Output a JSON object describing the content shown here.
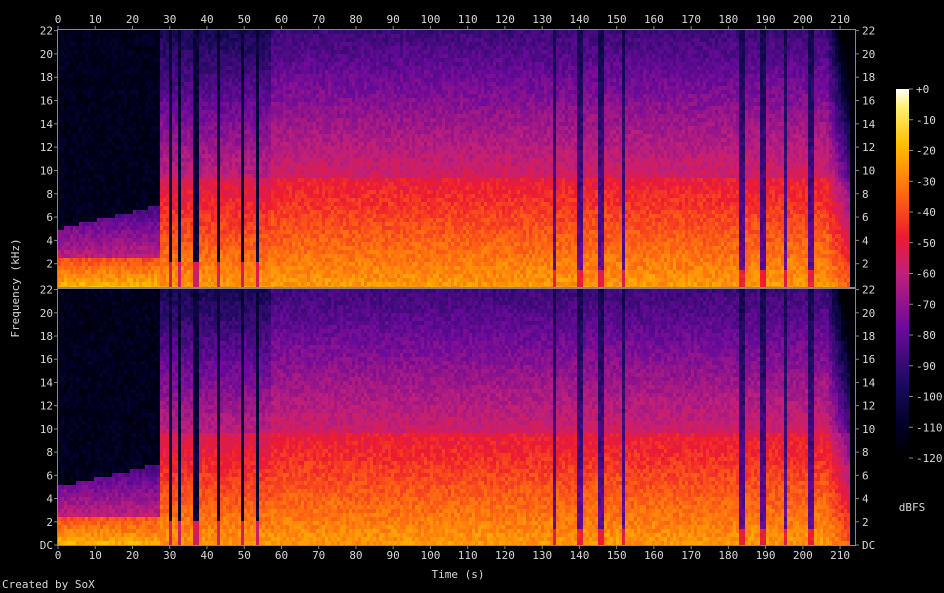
{
  "footer": "Created by SoX",
  "chart_data": {
    "type": "heatmap",
    "title": "",
    "xlabel": "Time (s)",
    "ylabel": "Frequency (kHz)",
    "xlim": [
      0,
      214
    ],
    "ylim": [
      0,
      22.05
    ],
    "x_ticks": [
      "0",
      "10",
      "20",
      "30",
      "40",
      "50",
      "60",
      "70",
      "80",
      "90",
      "100",
      "110",
      "120",
      "130",
      "140",
      "150",
      "160",
      "170",
      "180",
      "190",
      "200",
      "210"
    ],
    "y_ticks_top": [
      "2",
      "4",
      "6",
      "8",
      "10",
      "12",
      "14",
      "16",
      "18",
      "20",
      "22"
    ],
    "y_ticks_bottom": [
      "DC",
      "2",
      "4",
      "6",
      "8",
      "10",
      "12",
      "14",
      "16",
      "18",
      "20",
      "22"
    ],
    "channels": 2,
    "colorbar": {
      "label": "dBFS",
      "range": [
        -120,
        0
      ],
      "ticks": [
        "+0",
        "-10",
        "-20",
        "-30",
        "-40",
        "-50",
        "-60",
        "-70",
        "-80",
        "-90",
        "-100",
        "-110",
        "-120"
      ]
    },
    "silent_intro_end_s": 27,
    "silent_gaps_s": [
      [
        29.5,
        30.2
      ],
      [
        32.2,
        33.0
      ],
      [
        35.8,
        37.2
      ],
      [
        42.0,
        43.3
      ],
      [
        48.5,
        49.6
      ],
      [
        52.5,
        53.7
      ]
    ],
    "quiet_dips_s": [
      133,
      139.5,
      145.5,
      151.5,
      183,
      189,
      195,
      201.5
    ],
    "fade_out_start_s": 206,
    "end_s": 212
  }
}
